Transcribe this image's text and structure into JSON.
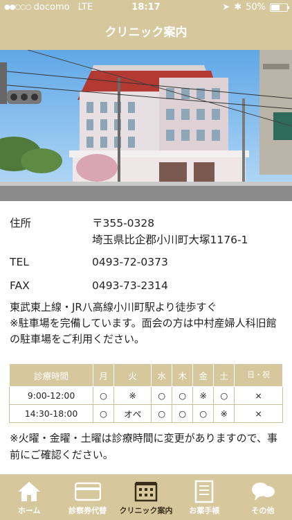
{
  "status": {
    "carrier": "docomo",
    "network": "LTE",
    "time": "18:17",
    "battery": "50%"
  },
  "header": {
    "title": "クリニック案内"
  },
  "info": {
    "address_label": "住所",
    "postal": "〒355-0328",
    "address": "埼玉県比企郡小川町大塚1176-1",
    "tel_label": "TEL",
    "tel": "0493-72-0373",
    "fax_label": "FAX",
    "fax": "0493-73-2314"
  },
  "notes": {
    "access": "東武東上線・JR八高線小川町駅より徒歩すぐ",
    "parking": "※駐車場を完備しています。面会の方は中村産婦人科旧館の駐車場をご利用ください。"
  },
  "schedule": {
    "headers": [
      "診療時間",
      "月",
      "火",
      "水",
      "木",
      "金",
      "土",
      "日・祝"
    ],
    "rows": [
      [
        "9:00-12:00",
        "○",
        "※",
        "○",
        "○",
        "※",
        "○",
        "×"
      ],
      [
        "14:30-18:00",
        "○",
        "オペ",
        "○",
        "○",
        "○",
        "※",
        "×"
      ]
    ]
  },
  "footnote": "※火曜・金曜・土曜は診療時間に変更がありますので、事前にご確認ください。",
  "tabs": [
    {
      "label": "ホーム",
      "icon": "home-icon"
    },
    {
      "label": "診察券代替",
      "icon": "card-icon"
    },
    {
      "label": "クリニック案内",
      "icon": "building-icon"
    },
    {
      "label": "お薬手帳",
      "icon": "notebook-icon"
    },
    {
      "label": "その他",
      "icon": "chat-bubble-icon"
    }
  ],
  "colors": {
    "accent": "#d6c79c",
    "active_tab": "#3a2e1a"
  }
}
